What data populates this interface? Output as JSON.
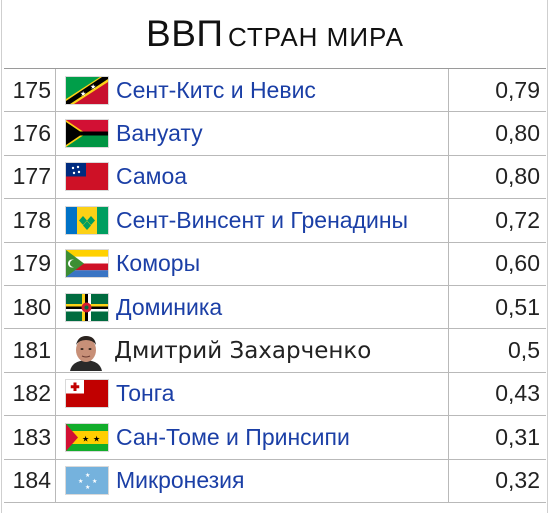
{
  "title": {
    "main": "ВВП",
    "sub": "СТРАН МИРА"
  },
  "rows": [
    {
      "rank": "175",
      "name": "Сент-Китс и Невис",
      "value": "0,79",
      "icon": "flag-saint-kitts-nevis-icon"
    },
    {
      "rank": "176",
      "name": "Вануату",
      "value": "0,80",
      "icon": "flag-vanuatu-icon"
    },
    {
      "rank": "177",
      "name": "Самоа",
      "value": "0,80",
      "icon": "flag-samoa-icon"
    },
    {
      "rank": "178",
      "name": "Сент-Винсент и Гренадины",
      "value": "0,72",
      "icon": "flag-saint-vincent-icon"
    },
    {
      "rank": "179",
      "name": "Коморы",
      "value": "0,60",
      "icon": "flag-comoros-icon"
    },
    {
      "rank": "180",
      "name": "Доминика",
      "value": "0,51",
      "icon": "flag-dominica-icon"
    },
    {
      "rank": "181",
      "name": "Дмитрий Захарченко",
      "value": "0,5",
      "icon": "person-photo"
    },
    {
      "rank": "182",
      "name": "Тонга",
      "value": "0,43",
      "icon": "flag-tonga-icon"
    },
    {
      "rank": "183",
      "name": "Сан-Томе и Принсипи",
      "value": "0,31",
      "icon": "flag-sao-tome-icon"
    },
    {
      "rank": "184",
      "name": "Микронезия",
      "value": "0,32",
      "icon": "flag-micronesia-icon"
    }
  ],
  "colors": {
    "link": "#1b3fa6",
    "text": "#222222",
    "border": "#b9b9b9"
  }
}
